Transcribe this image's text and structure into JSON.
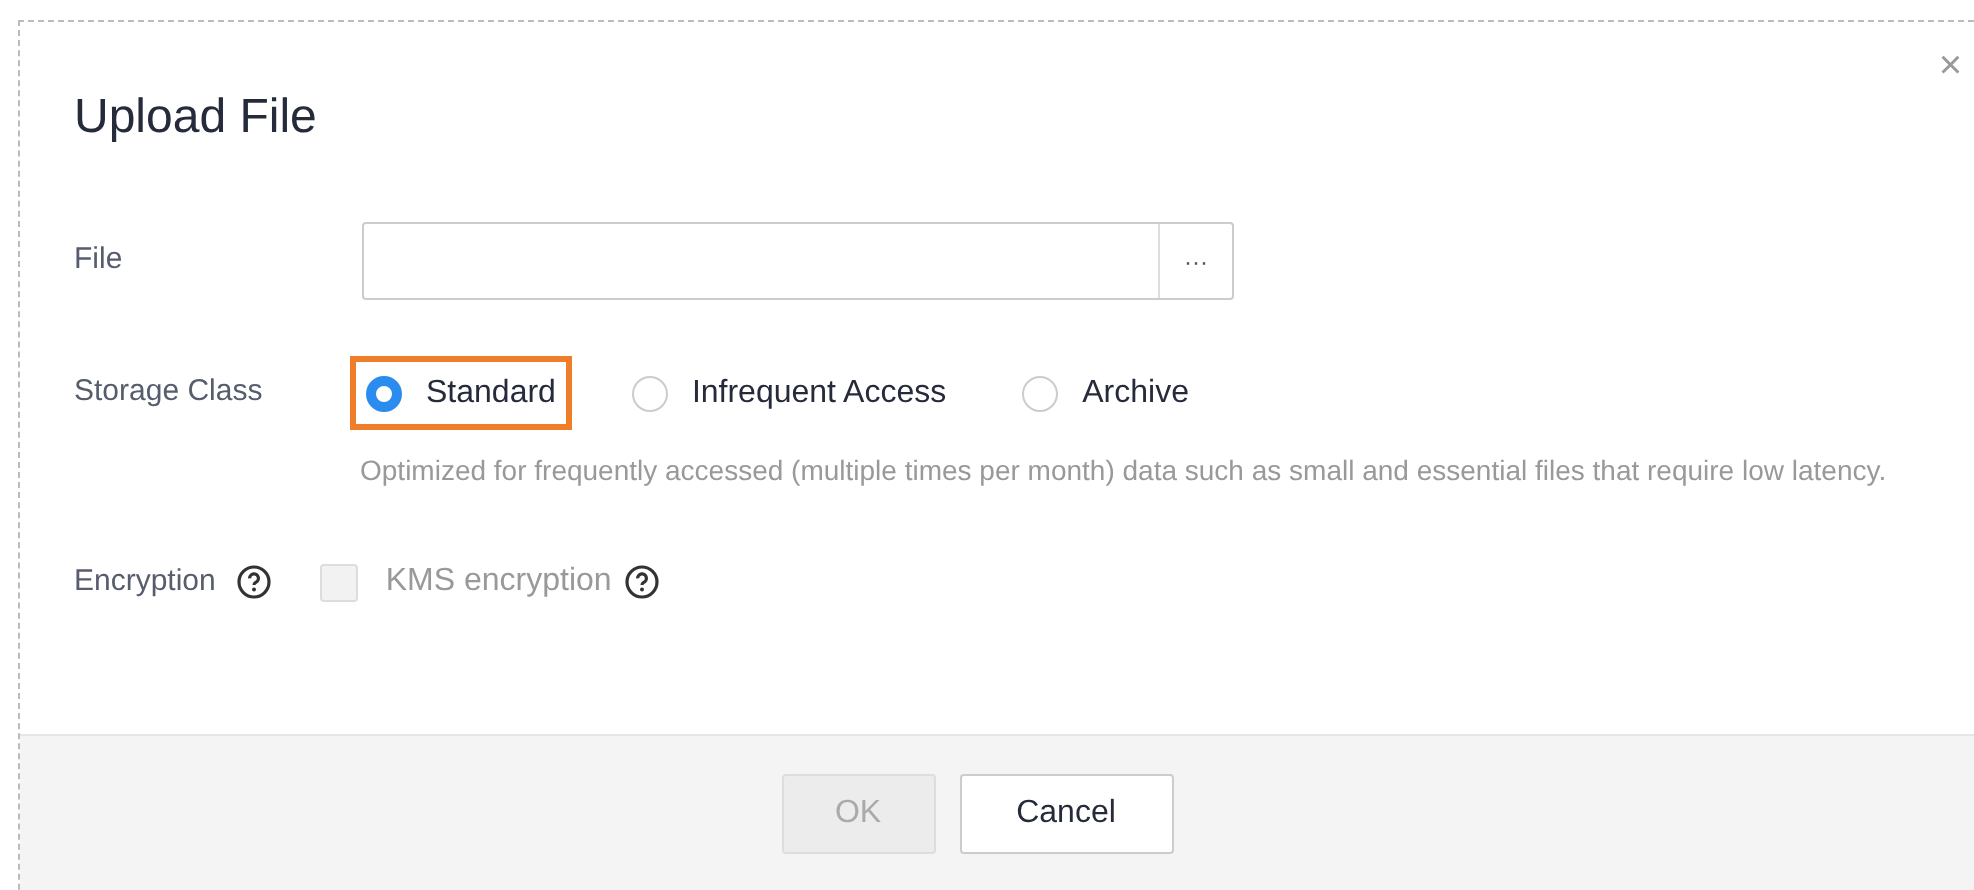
{
  "dialog": {
    "title": "Upload File",
    "close": "×"
  },
  "file": {
    "label": "File",
    "browse": "···"
  },
  "storage_class": {
    "label": "Storage Class",
    "options": [
      {
        "label": "Standard",
        "selected": true,
        "highlighted": true
      },
      {
        "label": "Infrequent Access",
        "selected": false,
        "highlighted": false
      },
      {
        "label": "Archive",
        "selected": false,
        "highlighted": false
      }
    ],
    "description": "Optimized for frequently accessed (multiple times per month) data such as small and essential files that require low latency."
  },
  "encryption": {
    "label": "Encryption",
    "option": {
      "label": "KMS encryption",
      "checked": false,
      "disabled": true
    }
  },
  "buttons": [
    {
      "label": "OK",
      "disabled": true
    },
    {
      "label": "Cancel",
      "disabled": false
    }
  ]
}
